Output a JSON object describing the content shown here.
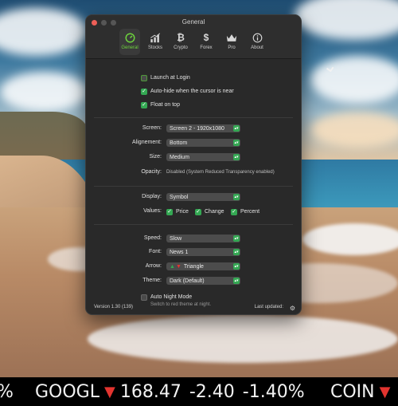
{
  "window": {
    "title": "General",
    "tabs": [
      {
        "label": "General",
        "icon": "gauge-icon",
        "active": true
      },
      {
        "label": "Stocks",
        "icon": "bar-chart-icon"
      },
      {
        "label": "Crypto",
        "icon": "bitcoin-icon"
      },
      {
        "label": "Forex",
        "icon": "dollar-icon"
      },
      {
        "label": "Pro",
        "icon": "crown-icon"
      },
      {
        "label": "About",
        "icon": "info-icon"
      }
    ]
  },
  "general": {
    "launch_at_login": {
      "label": "Launch at Login",
      "checked": false
    },
    "auto_hide": {
      "label": "Auto-hide when the cursor is near",
      "checked": true
    },
    "float_on_top": {
      "label": "Float on top",
      "checked": true
    },
    "screen": {
      "label": "Screen:",
      "value": "Screen 2 - 1920x1080"
    },
    "alignment": {
      "label": "Alignement:",
      "value": "Bottom"
    },
    "size": {
      "label": "Size:",
      "value": "Medium"
    },
    "opacity": {
      "label": "Opacity:",
      "value": "Disabled (System Reduced Transparency enabled)"
    },
    "display": {
      "label": "Display:",
      "value": "Symbol"
    },
    "values": {
      "label": "Values:",
      "price": "Price",
      "change": "Change",
      "percent": "Percent"
    },
    "speed": {
      "label": "Speed:",
      "value": "Slow"
    },
    "font": {
      "label": "Font:",
      "value": "News 1"
    },
    "arrow": {
      "label": "Arrow:",
      "value": "Triangle"
    },
    "theme": {
      "label": "Theme:",
      "value": "Dark (Default)"
    },
    "night_mode": {
      "label": "Auto Night Mode",
      "checked": false,
      "hint": "Switch to red theme at night."
    }
  },
  "footer": {
    "version": "Version 1.30 (139)",
    "last_updated": "Last updated:"
  },
  "ticker": {
    "leading": "%",
    "item1": {
      "symbol": "GOOGL",
      "price": "168.47",
      "change": "-2.40",
      "percent": "-1.40%"
    },
    "item2": {
      "symbol": "COIN"
    }
  },
  "colors": {
    "accent_green": "#34a853",
    "down_red": "#e3342f"
  }
}
